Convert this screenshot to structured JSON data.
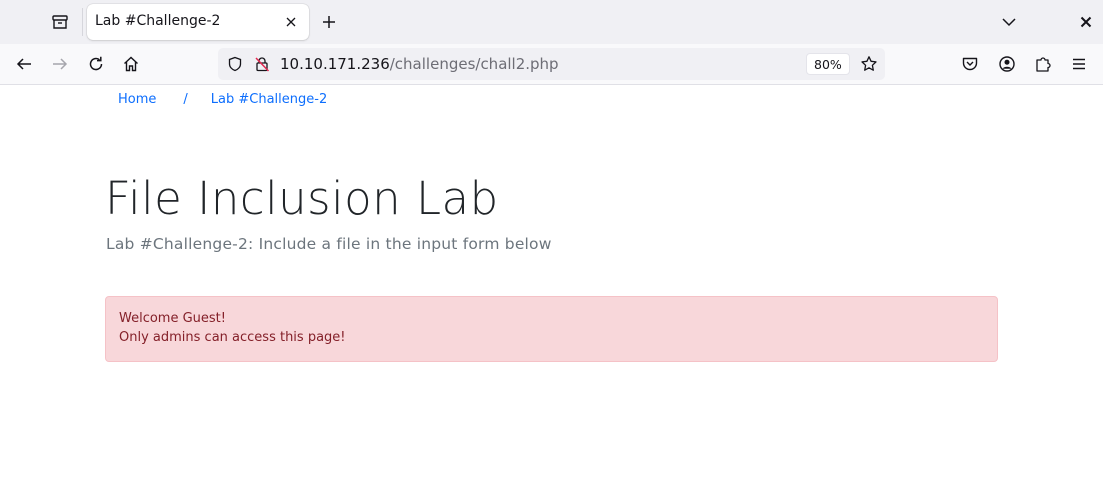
{
  "browser": {
    "tab": {
      "title": "Lab #Challenge-2"
    },
    "url": {
      "host": "10.10.171.236",
      "path": "/challenges/chall2.php"
    },
    "zoom": "80%"
  },
  "page": {
    "breadcrumb": {
      "home": "Home",
      "separator": "/",
      "current": "Lab #Challenge-2"
    },
    "title": "File Inclusion Lab",
    "subtitle": "Lab #Challenge-2: Include a file in the input form below",
    "alert": {
      "line1": "Welcome Guest!",
      "line2": "Only admins can access this page!"
    }
  },
  "colors": {
    "link": "#0d6efd",
    "alert_bg": "#f8d7da",
    "alert_text": "#842029"
  }
}
